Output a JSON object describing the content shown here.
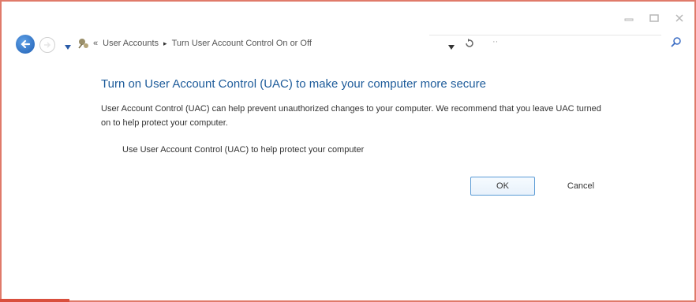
{
  "breadcrumb": {
    "chevrons": "«",
    "items": [
      "User Accounts",
      "Turn User Account Control On or Off"
    ],
    "separator": "▸"
  },
  "search": {
    "placeholder_dots": "··"
  },
  "main": {
    "title": "Turn on User Account Control (UAC) to make your computer more secure",
    "description": "User Account Control (UAC) can help prevent unauthorized changes to your computer. We recommend that you leave UAC turned on to help protect your computer.",
    "checkbox_label": "Use User Account Control (UAC) to help protect your computer",
    "checkbox_checked": false
  },
  "buttons": {
    "ok": "OK",
    "cancel": "Cancel"
  },
  "colors": {
    "accent": "#1d5b9a",
    "frame": "#e07a6a",
    "ok_border": "#5b9bd5"
  },
  "icons": {
    "back": "back-arrow-icon",
    "forward": "forward-arrow-icon",
    "history": "chevron-down-icon",
    "location": "control-panel-icon",
    "refresh": "refresh-icon",
    "search": "search-icon",
    "minimize": "minimize-icon",
    "maximize": "maximize-icon",
    "close": "close-icon"
  }
}
